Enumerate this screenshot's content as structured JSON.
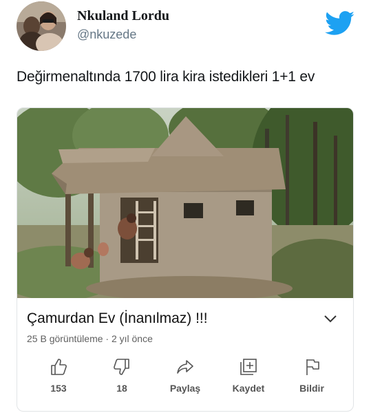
{
  "user": {
    "display_name": "Nkuland Lordu",
    "handle": "@nkuzede",
    "avatar_icon": "profile-photo",
    "brand_icon": "twitter-bird-icon",
    "brand_color": "#1DA1F2"
  },
  "tweet": {
    "text": "Değirmenaltında 1700 lira kira istedikleri 1+1 ev"
  },
  "video": {
    "thumbnail_description_icon": "video-thumbnail",
    "title": "Çamurdan Ev (İnanılmaz) !!!",
    "meta": "25 B görüntüleme · 2 yıl önce",
    "expand_icon": "chevron-down-icon"
  },
  "actions": [
    {
      "icon": "thumbs-up-icon",
      "label": "153"
    },
    {
      "icon": "thumbs-down-icon",
      "label": "18"
    },
    {
      "icon": "share-icon",
      "label": "Paylaş"
    },
    {
      "icon": "add-to-playlist-icon",
      "label": "Kaydet"
    },
    {
      "icon": "flag-icon",
      "label": "Bildir"
    }
  ]
}
